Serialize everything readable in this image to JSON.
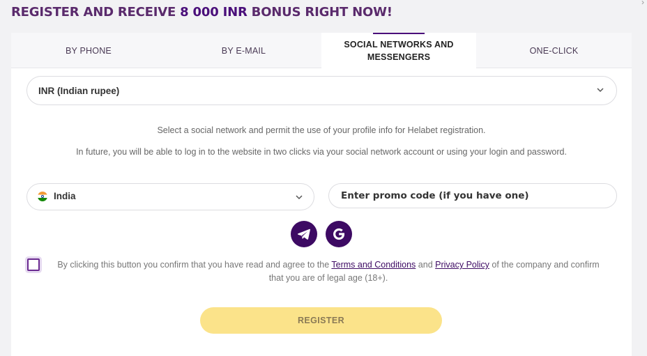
{
  "header": {
    "title_prefix": "REGISTER AND RECEIVE ",
    "title_bonus": "8 000 INR",
    "title_suffix": " BONUS RIGHT NOW!"
  },
  "tabs": [
    {
      "label": "BY PHONE",
      "active": false
    },
    {
      "label": "BY E-MAIL",
      "active": false
    },
    {
      "label": "SOCIAL NETWORKS AND MESSENGERS",
      "active": true
    },
    {
      "label": "ONE-CLICK",
      "active": false
    }
  ],
  "currency": {
    "selected": "INR (Indian rupee)"
  },
  "info": {
    "line1": "Select a social network and permit the use of your profile info for Helabet registration.",
    "line2": "In future, you will be able to log in to the website in two clicks via your social network account or using your login and password."
  },
  "country": {
    "selected": "India",
    "flag_icon": "india-flag-icon"
  },
  "promo": {
    "placeholder": "Enter promo code (if you have one)",
    "value": ""
  },
  "social": [
    {
      "name": "Telegram",
      "icon": "telegram-icon"
    },
    {
      "name": "Google",
      "icon": "google-icon"
    }
  ],
  "consent": {
    "checked": false,
    "text_before": "By clicking this button you confirm that you have read and agree to the ",
    "terms_link": "Terms and Conditions",
    "text_mid": " and ",
    "privacy_link": "Privacy Policy",
    "text_after": " of the company and confirm that you are of legal age (18+)."
  },
  "register": {
    "label": "REGISTER"
  },
  "colors": {
    "brand": "#3d0a63",
    "title": "#5a2a6c",
    "register_button": "#fbe38a"
  }
}
